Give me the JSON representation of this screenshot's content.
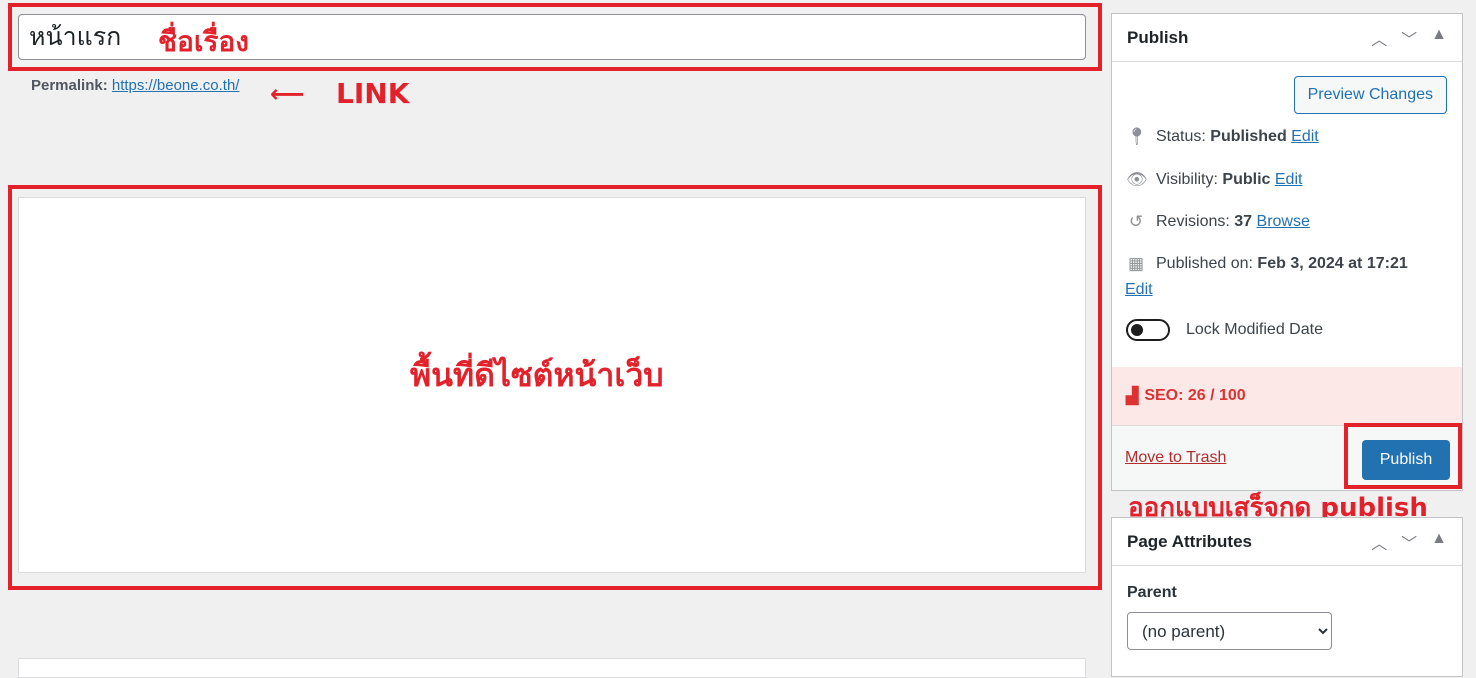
{
  "title_field": {
    "value": "หน้าแรก"
  },
  "permalink": {
    "label": "Permalink:",
    "url": "https://beone.co.th/"
  },
  "annotations": {
    "title": "ชื่อเรื่อง",
    "link": "LINK",
    "editor": "พื้นที่ดีไซต์หน้าเว็บ",
    "publish": "ออกแบบเสร็จกด publish",
    "color": "#e3212b"
  },
  "publish_panel": {
    "title": "Publish",
    "preview_label": "Preview Changes",
    "status": {
      "label": "Status:",
      "value": "Published",
      "action": "Edit"
    },
    "visibility": {
      "label": "Visibility:",
      "value": "Public",
      "action": "Edit"
    },
    "revisions": {
      "label": "Revisions:",
      "value": "37",
      "action": "Browse"
    },
    "published_on": {
      "label": "Published on:",
      "value": "Feb 3, 2024 at 17:21",
      "action": "Edit"
    },
    "lock_label": "Lock Modified Date",
    "seo": "SEO: 26 / 100",
    "trash_label": "Move to Trash",
    "publish_label": "Publish"
  },
  "page_attributes": {
    "title": "Page Attributes",
    "parent_label": "Parent",
    "parent_value": "(no parent)"
  }
}
